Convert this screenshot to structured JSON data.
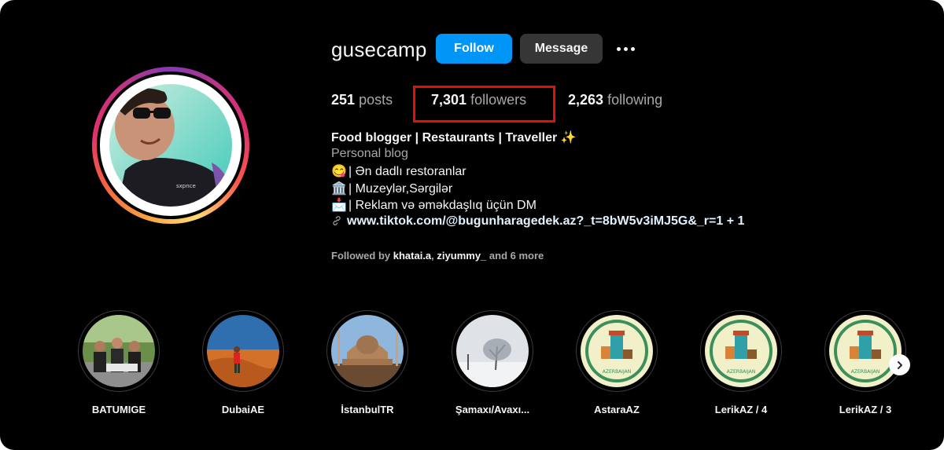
{
  "profile": {
    "username": "gusecamp",
    "follow_label": "Follow",
    "message_label": "Message",
    "stats": {
      "posts_count": "251",
      "posts_label": "posts",
      "followers_count": "7,301",
      "followers_label": "followers",
      "following_count": "2,263",
      "following_label": "following"
    }
  },
  "bio": {
    "name_line": "Food blogger | Restaurants | Traveller ✨",
    "category": "Personal blog",
    "lines": [
      {
        "emoji": "😋",
        "text": "| Ən dadlı restoranlar"
      },
      {
        "emoji": "🏛️",
        "text": "| Muzeylər,Sərgilər"
      },
      {
        "emoji": "📩",
        "text": "| Reklam və əməkdaşlıq üçün DM"
      }
    ],
    "link_text": "www.tiktok.com/@bugunharagedek.az?_t=8bW5v3iMJ5G&_r=1 + 1"
  },
  "followed_by": {
    "prefix": "Followed by",
    "user1": "khatai.a",
    "separator": ",",
    "user2": "ziyummy_",
    "suffix": "and 6 more"
  },
  "highlights": [
    {
      "label": "BATUMIGE",
      "name": "BATUMİ",
      "flag": "GE",
      "image": "group-photo"
    },
    {
      "label": "DubaiAE",
      "name": "Dubai",
      "flag": "AE",
      "image": "desert"
    },
    {
      "label": "İstanbulTR",
      "name": "İstanbul",
      "flag": "TR",
      "image": "mosque"
    },
    {
      "label": "Şamaxı/Avaxı...",
      "name": "Şamaxı/Avaxı...",
      "flag": "",
      "image": "snow-tree"
    },
    {
      "label": "AstaraAZ",
      "name": "Astara",
      "flag": "AZ",
      "image": "azerbaijan-badge"
    },
    {
      "label": "LerikAZ / 4",
      "name": "Lerik",
      "flag": "AZ / 4",
      "image": "azerbaijan-badge"
    },
    {
      "label": "LerikAZ / 3",
      "name": "Lerik",
      "flag": "AZ / 3",
      "image": "azerbaijan-badge"
    }
  ],
  "badge_text": "AZERBAIJAN",
  "colors": {
    "follow_button": "#0095f6",
    "message_button": "#363636",
    "highlight_box": "#e20f0f",
    "background": "#000000"
  }
}
